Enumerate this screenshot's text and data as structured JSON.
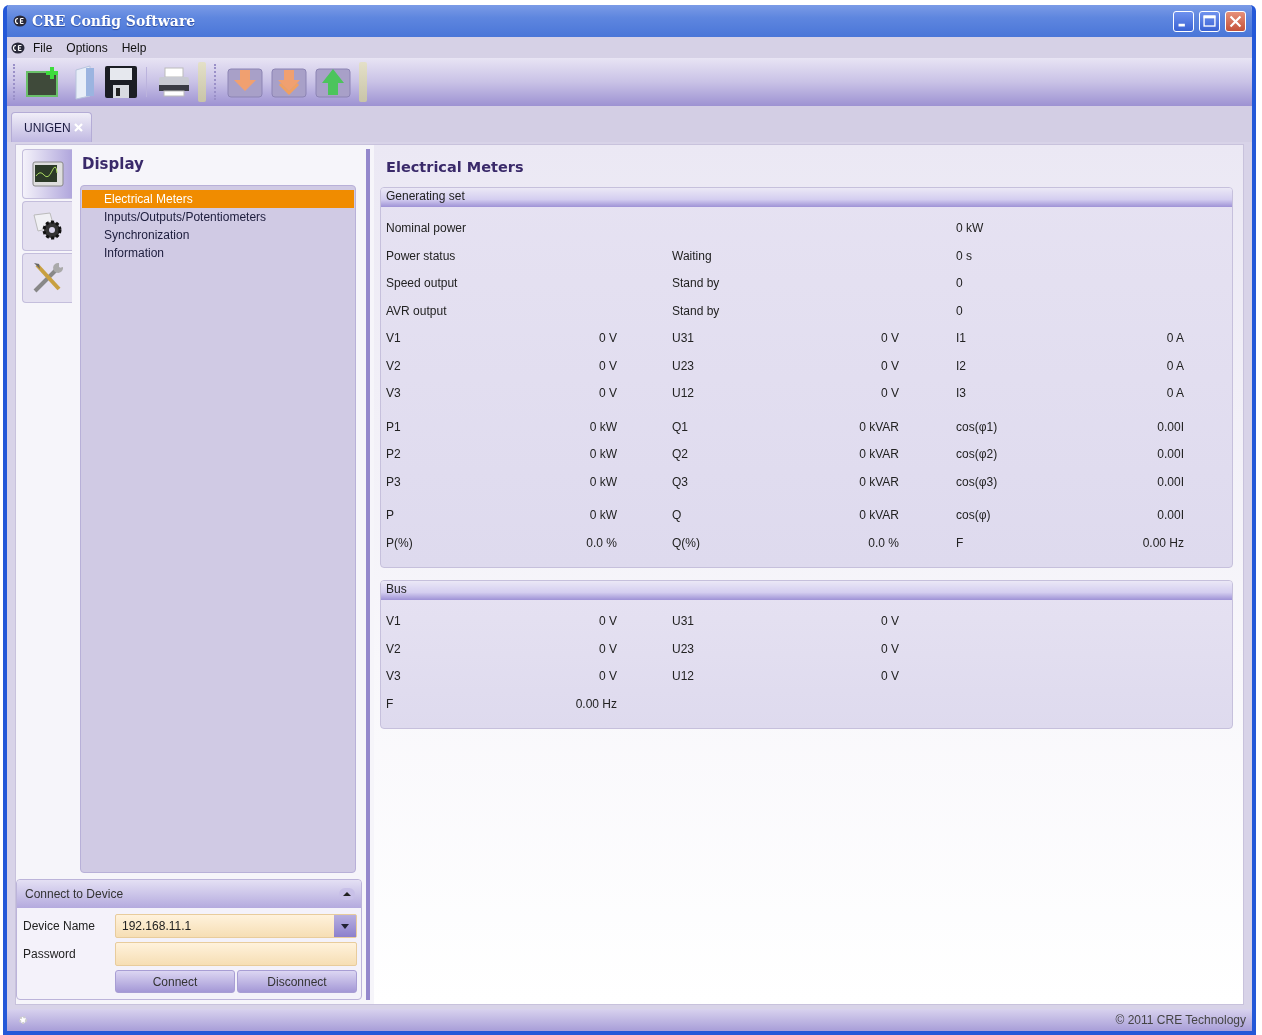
{
  "window": {
    "title": "CRE Config Software"
  },
  "menu": [
    "File",
    "Options",
    "Help"
  ],
  "doc_tabs": [
    {
      "label": "UNIGEN",
      "selected": true
    }
  ],
  "side_tabs": [
    {
      "kind": "display",
      "selected": true
    },
    {
      "kind": "settings",
      "selected": false
    },
    {
      "kind": "tools",
      "selected": false
    }
  ],
  "nav": {
    "title": "Display",
    "items": [
      {
        "label": "Electrical Meters",
        "selected": true
      },
      {
        "label": "Inputs/Outputs/Potentiometers",
        "selected": false
      },
      {
        "label": "Synchronization",
        "selected": false
      },
      {
        "label": "Information",
        "selected": false
      }
    ]
  },
  "connect": {
    "title": "Connect to Device",
    "expanded": true,
    "device_name": {
      "label": "Device Name",
      "value": "192.168.11.1"
    },
    "password": {
      "label": "Password"
    },
    "buttons": [
      "Connect",
      "Disconnect"
    ]
  },
  "content": {
    "title": "Electrical Meters",
    "sections": [
      {
        "title": "Generating set",
        "groups": [
          [
            {
              "kind": "status",
              "label": "Nominal power",
              "value": "0 kW"
            },
            {
              "kind": "status",
              "label": "Power status",
              "state": "Waiting",
              "value": "0 s"
            },
            {
              "kind": "status",
              "label": "Speed output",
              "state": "Stand by",
              "value": "0"
            },
            {
              "kind": "status",
              "label": "AVR output",
              "state": "Stand by",
              "value": "0"
            },
            {
              "kind": "pairs",
              "cells": [
                {
                  "label": "V1",
                  "value": "0 V"
                },
                {
                  "label": "U31",
                  "value": "0 V"
                },
                {
                  "label": "I1",
                  "value": "0 A"
                }
              ]
            },
            {
              "kind": "pairs",
              "cells": [
                {
                  "label": "V2",
                  "value": "0 V"
                },
                {
                  "label": "U23",
                  "value": "0 V"
                },
                {
                  "label": "I2",
                  "value": "0 A"
                }
              ]
            },
            {
              "kind": "pairs",
              "cells": [
                {
                  "label": "V3",
                  "value": "0 V"
                },
                {
                  "label": "U12",
                  "value": "0 V"
                },
                {
                  "label": "I3",
                  "value": "0 A"
                }
              ]
            }
          ],
          [
            {
              "kind": "pairs",
              "cells": [
                {
                  "label": "P1",
                  "value": "0 kW"
                },
                {
                  "label": "Q1",
                  "value": "0 kVAR"
                },
                {
                  "label": "cos(φ1)",
                  "value": "0.00I"
                }
              ]
            },
            {
              "kind": "pairs",
              "cells": [
                {
                  "label": "P2",
                  "value": "0 kW"
                },
                {
                  "label": "Q2",
                  "value": "0 kVAR"
                },
                {
                  "label": "cos(φ2)",
                  "value": "0.00I"
                }
              ]
            },
            {
              "kind": "pairs",
              "cells": [
                {
                  "label": "P3",
                  "value": "0 kW"
                },
                {
                  "label": "Q3",
                  "value": "0 kVAR"
                },
                {
                  "label": "cos(φ3)",
                  "value": "0.00I"
                }
              ]
            }
          ],
          [
            {
              "kind": "pairs",
              "cells": [
                {
                  "label": "P",
                  "value": "0 kW"
                },
                {
                  "label": "Q",
                  "value": "0 kVAR"
                },
                {
                  "label": "cos(φ)",
                  "value": "0.00I"
                }
              ]
            },
            {
              "kind": "pairs",
              "cells": [
                {
                  "label": "P(%)",
                  "value": "0.0 %"
                },
                {
                  "label": "Q(%)",
                  "value": "0.0 %"
                },
                {
                  "label": "F",
                  "value": "0.00 Hz"
                }
              ]
            }
          ]
        ]
      },
      {
        "title": "Bus",
        "groups": [
          [
            {
              "kind": "pairs",
              "cells": [
                {
                  "label": "V1",
                  "value": "0 V"
                },
                {
                  "label": "U31",
                  "value": "0 V"
                }
              ]
            },
            {
              "kind": "pairs",
              "cells": [
                {
                  "label": "V2",
                  "value": "0 V"
                },
                {
                  "label": "U23",
                  "value": "0 V"
                }
              ]
            },
            {
              "kind": "pairs",
              "cells": [
                {
                  "label": "V3",
                  "value": "0 V"
                },
                {
                  "label": "U12",
                  "value": "0 V"
                }
              ]
            },
            {
              "kind": "pairs",
              "cells": [
                {
                  "label": "F",
                  "value": "0.00 Hz"
                }
              ]
            }
          ]
        ]
      }
    ]
  },
  "status_bar": {
    "copyright": "© 2011 CRE Technology"
  }
}
